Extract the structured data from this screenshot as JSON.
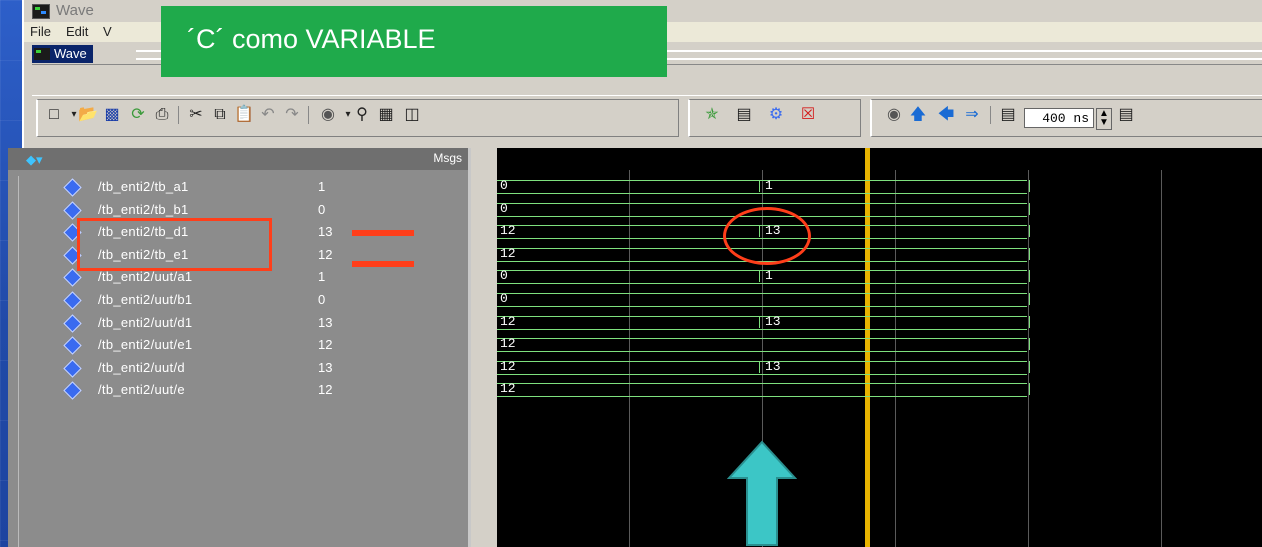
{
  "window": {
    "title": "Wave"
  },
  "menu": {
    "items": [
      "File",
      "Edit",
      "V"
    ]
  },
  "banner": {
    "text": "´C´ como VARIABLE"
  },
  "wave_tab": {
    "label": "Wave"
  },
  "toolbar": {
    "time_value": "400 ns",
    "icons": [
      "new-icon",
      "open-icon",
      "save-icon",
      "reload-icon",
      "print-icon",
      "cut-icon",
      "copy-icon",
      "paste-icon",
      "undo-icon",
      "redo-icon",
      "find-icon",
      "binoculars-icon",
      "zoom-icon",
      "dataflow-icon",
      "wave-cursor-icon",
      "bookmark-icon",
      "restart-icon",
      "close-wave-icon",
      "sim-icon",
      "up-arrow-icon",
      "left-arrow-icon",
      "right-arrow-icon",
      "run-icon",
      "step-icon"
    ]
  },
  "signals_header": {
    "msgs_label": "Msgs"
  },
  "signals": [
    {
      "name": "/tb_enti2/tb_a1",
      "value": "1",
      "wave_before": "0",
      "wave_after": "1"
    },
    {
      "name": "/tb_enti2/tb_b1",
      "value": "0",
      "wave_before": "0",
      "wave_after": ""
    },
    {
      "name": "/tb_enti2/tb_d1",
      "value": "13",
      "wave_before": "12",
      "wave_after": "13"
    },
    {
      "name": "/tb_enti2/tb_e1",
      "value": "12",
      "wave_before": "12",
      "wave_after": ""
    },
    {
      "name": "/tb_enti2/uut/a1",
      "value": "1",
      "wave_before": "0",
      "wave_after": "1"
    },
    {
      "name": "/tb_enti2/uut/b1",
      "value": "0",
      "wave_before": "0",
      "wave_after": ""
    },
    {
      "name": "/tb_enti2/uut/d1",
      "value": "13",
      "wave_before": "12",
      "wave_after": "13"
    },
    {
      "name": "/tb_enti2/uut/e1",
      "value": "12",
      "wave_before": "12",
      "wave_after": ""
    },
    {
      "name": "/tb_enti2/uut/d",
      "value": "13",
      "wave_before": "12",
      "wave_after": "13"
    },
    {
      "name": "/tb_enti2/uut/e",
      "value": "12",
      "wave_before": "12",
      "wave_after": ""
    }
  ],
  "colors": {
    "annotation": "#ff3e1a",
    "arrow": "#3cc6c6",
    "bus": "#7ee07e",
    "cursor": "#e8b400",
    "banner": "#1faa4b"
  }
}
